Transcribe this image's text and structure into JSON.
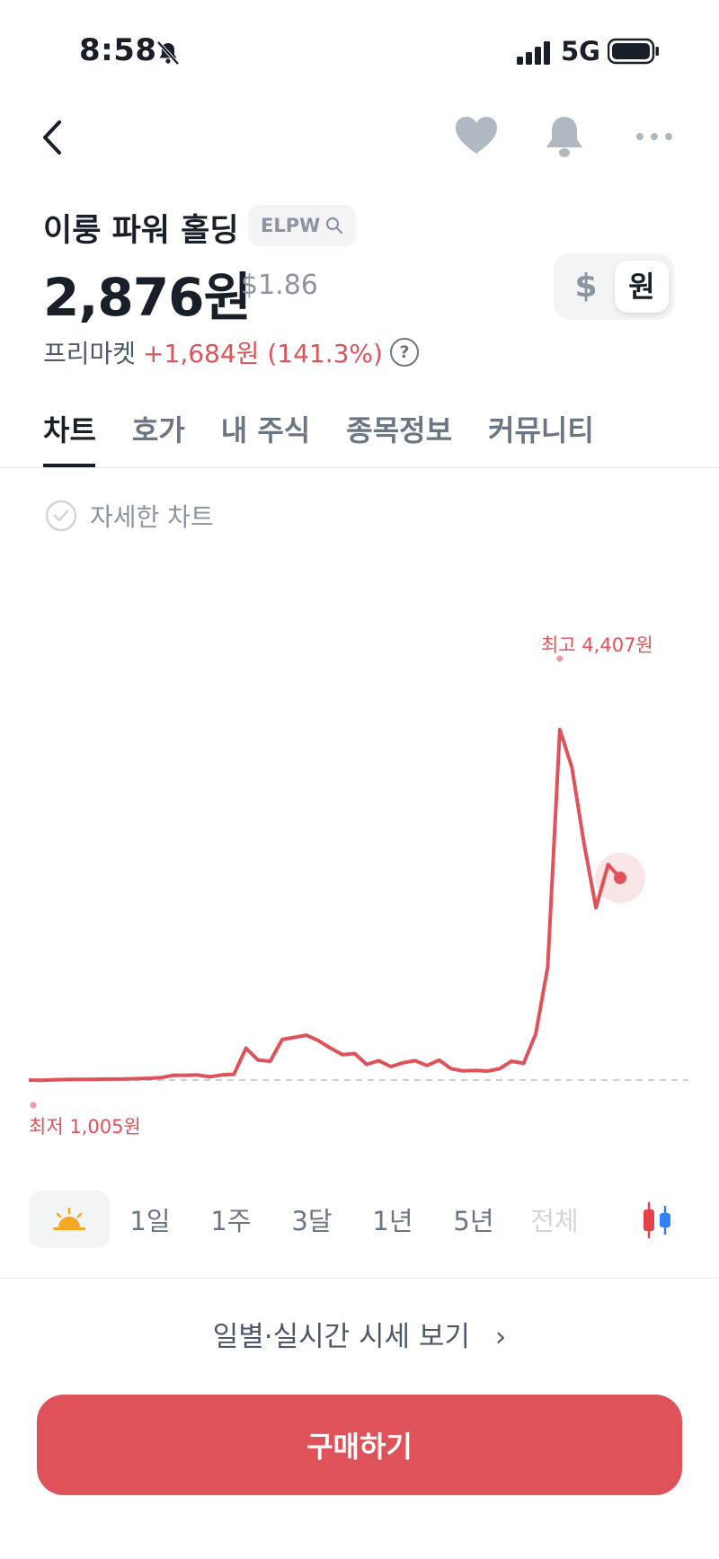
{
  "status": {
    "time": "8:58",
    "network": "5G"
  },
  "stock": {
    "name": "이룽 파워 홀딩",
    "ticker": "ELPW",
    "price": "2,876원",
    "usd_price": "$1.86",
    "currency_toggle": {
      "dollar": "$",
      "won": "원",
      "selected": "원"
    },
    "premarket_label": "프리마켓",
    "premarket_change": "+1,684원 (141.3%)",
    "help": "?"
  },
  "tabs": [
    {
      "label": "차트",
      "active": true
    },
    {
      "label": "호가",
      "active": false
    },
    {
      "label": "내 주식",
      "active": false
    },
    {
      "label": "종목정보",
      "active": false
    },
    {
      "label": "커뮤니티",
      "active": false
    }
  ],
  "detail_chart_label": "자세한 차트",
  "chart": {
    "high_label": "최고 4,407원",
    "low_label": "최저 1,005원",
    "line_color": "#e0525a"
  },
  "chart_data": {
    "type": "line",
    "series": [
      {
        "values": [
          1005,
          1003,
          1007,
          1010,
          1011,
          1012,
          1013,
          1014,
          1015,
          1018,
          1022,
          1028,
          1050,
          1048,
          1052,
          1035,
          1052,
          1058,
          1300,
          1190,
          1180,
          1380,
          1400,
          1420,
          1370,
          1300,
          1240,
          1250,
          1150,
          1185,
          1130,
          1165,
          1185,
          1140,
          1190,
          1110,
          1090,
          1095,
          1088,
          1110,
          1180,
          1160,
          1430,
          2050,
          4250,
          3900,
          3200,
          2600,
          3000,
          2876
        ]
      }
    ],
    "high": 4407,
    "low": 1005,
    "ylim": [
      1005,
      4407
    ],
    "grid": false
  },
  "ranges": [
    "1일",
    "1주",
    "3달",
    "1년",
    "5년",
    "전체"
  ],
  "daily_link": "일별·실시간 시세 보기",
  "buy_button": "구매하기",
  "colors": {
    "accent": "#e0525a",
    "text": "#191f28",
    "muted": "#8b95a1"
  }
}
